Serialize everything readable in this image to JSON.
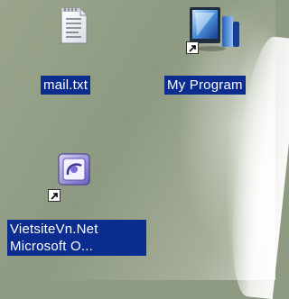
{
  "desktop": {
    "icons": [
      {
        "label": "mail.txt",
        "icon": "text-file-icon",
        "shortcut": false
      },
      {
        "label": "My Program",
        "icon": "program-shortcut-icon",
        "shortcut": true
      },
      {
        "label_line1": "VietsiteVn.Net",
        "label_line2": "Microsoft O...",
        "icon": "office-shortcut-icon",
        "shortcut": true
      }
    ]
  },
  "colors": {
    "selection": "#0a2d8f",
    "label_text": "#ffffff"
  }
}
